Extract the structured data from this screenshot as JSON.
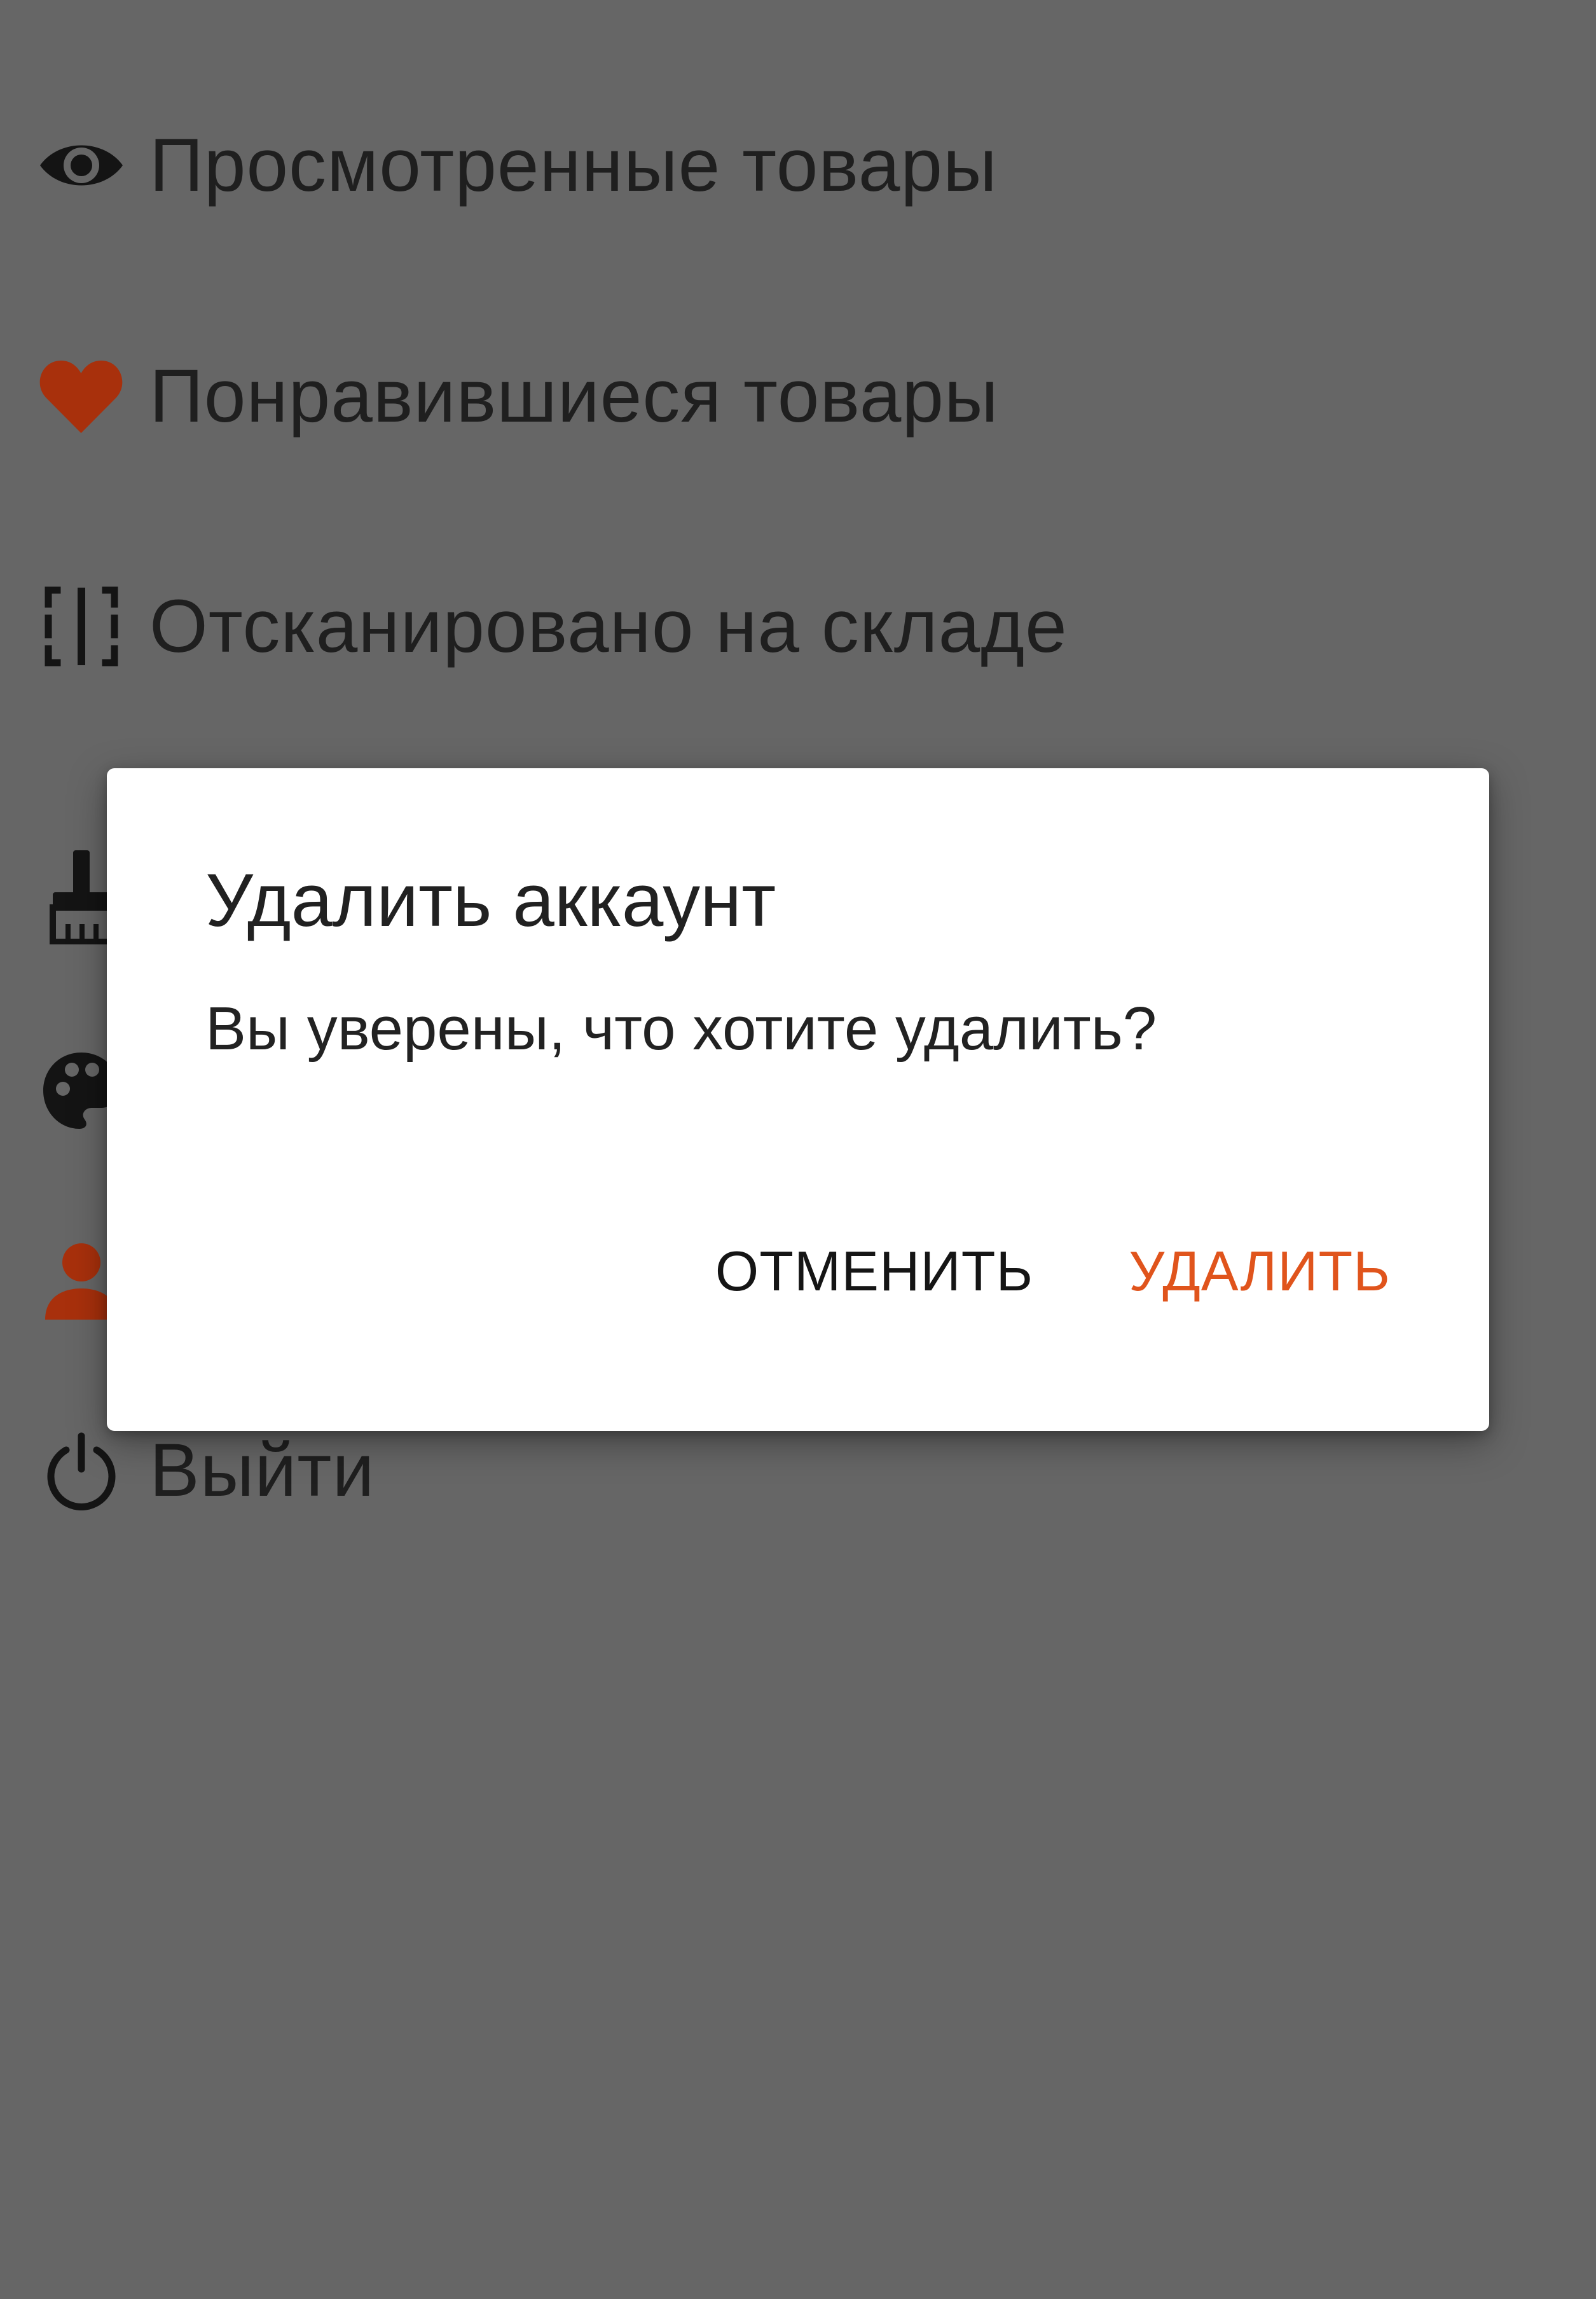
{
  "menu": {
    "items": [
      {
        "label": "Просмотренные товары",
        "icon": "eye-icon"
      },
      {
        "label": "Понравившиеся товары",
        "icon": "heart-icon"
      },
      {
        "label": "Отсканировано на складе",
        "icon": "scan-icon"
      },
      {
        "label": "",
        "icon": "broom-icon"
      },
      {
        "label": "",
        "icon": "palette-icon"
      },
      {
        "label": "",
        "icon": "person-icon"
      },
      {
        "label": "Выйти",
        "icon": "power-icon"
      }
    ]
  },
  "dialog": {
    "title": "Удалить аккаунт",
    "message": "Вы уверены, что хотите удалить?",
    "cancel_label": "ОТМЕНИТЬ",
    "confirm_label": "УДАЛИТЬ"
  },
  "colors": {
    "scrim_background": "#666666",
    "accent": "#e0541c",
    "icon_red": "#a8300c",
    "icon_dark": "#1a1a1a",
    "dialog_background": "#ffffff"
  }
}
